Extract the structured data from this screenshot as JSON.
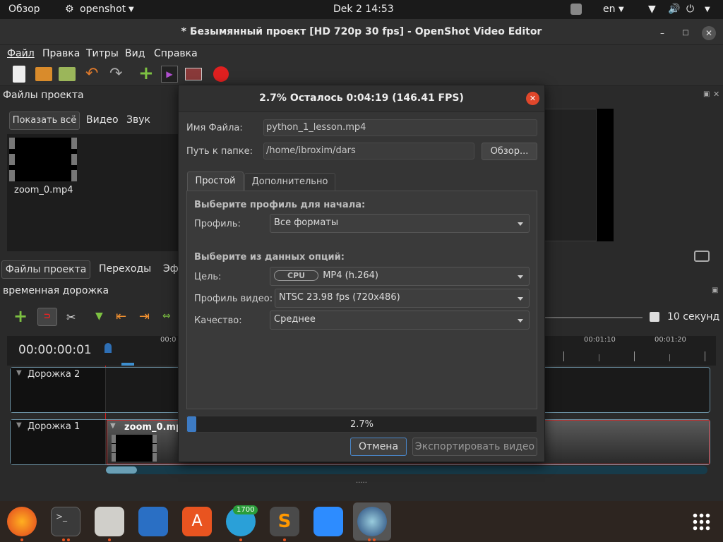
{
  "topbar": {
    "activities": "Обзор",
    "app_menu": "openshot",
    "clock": "Dek 2  14:53",
    "lang": "en"
  },
  "window": {
    "title": "* Безымянный проект [HD 720p 30 fps] - OpenShot Video Editor"
  },
  "menu": {
    "file": "Файл",
    "edit": "Правка",
    "titles": "Титры",
    "view": "Вид",
    "help": "Справка"
  },
  "project_files": {
    "header": "Файлы проекта",
    "filter_all": "Показать всё",
    "filter_video": "Видео",
    "filter_audio": "Звук",
    "file_name": "zoom_0.mp4"
  },
  "bottom_tabs": {
    "files": "Файлы проекта",
    "transitions": "Переходы",
    "effects": "Эф"
  },
  "timeline": {
    "header": "временная дорожка",
    "timecode": "00:00:00:01",
    "zoom_label": "10 секунд",
    "ruler_start": "00:0",
    "ruler_1": "00:01:10",
    "ruler_2": "00:01:20",
    "track2": "Дорожка 2",
    "track1": "Дорожка 1",
    "clip_name": "zoom_0.mp"
  },
  "dialog": {
    "header": "2.7%  Осталось 0:04:19 (146.41 FPS)",
    "filename_label": "Имя Файла:",
    "filename_value": "python_1_lesson.mp4",
    "folder_label": "Путь к папке:",
    "folder_value": "/home/ibroxim/dars",
    "browse": "Обзор...",
    "tab_simple": "Простой",
    "tab_advanced": "Дополнительно",
    "section1": "Выберите профиль для начала:",
    "profile_label": "Профиль:",
    "profile_value": "Все форматы",
    "section2": "Выберите из данных опций:",
    "target_label": "Цель:",
    "target_badge": "CPU",
    "target_value": "MP4 (h.264)",
    "video_profile_label": "Профиль видео:",
    "video_profile_value": "NTSC 23.98 fps (720x486)",
    "quality_label": "Качество:",
    "quality_value": "Среднее",
    "progress_text": "2.7%",
    "progress": 0.027,
    "cancel": "Отмена",
    "export": "Экспортировать видео"
  },
  "dock": {
    "telegram_badge": "1700"
  },
  "colors": {
    "accent": "#e95420",
    "progress": "#3d7bc4",
    "close": "#e0472b"
  }
}
